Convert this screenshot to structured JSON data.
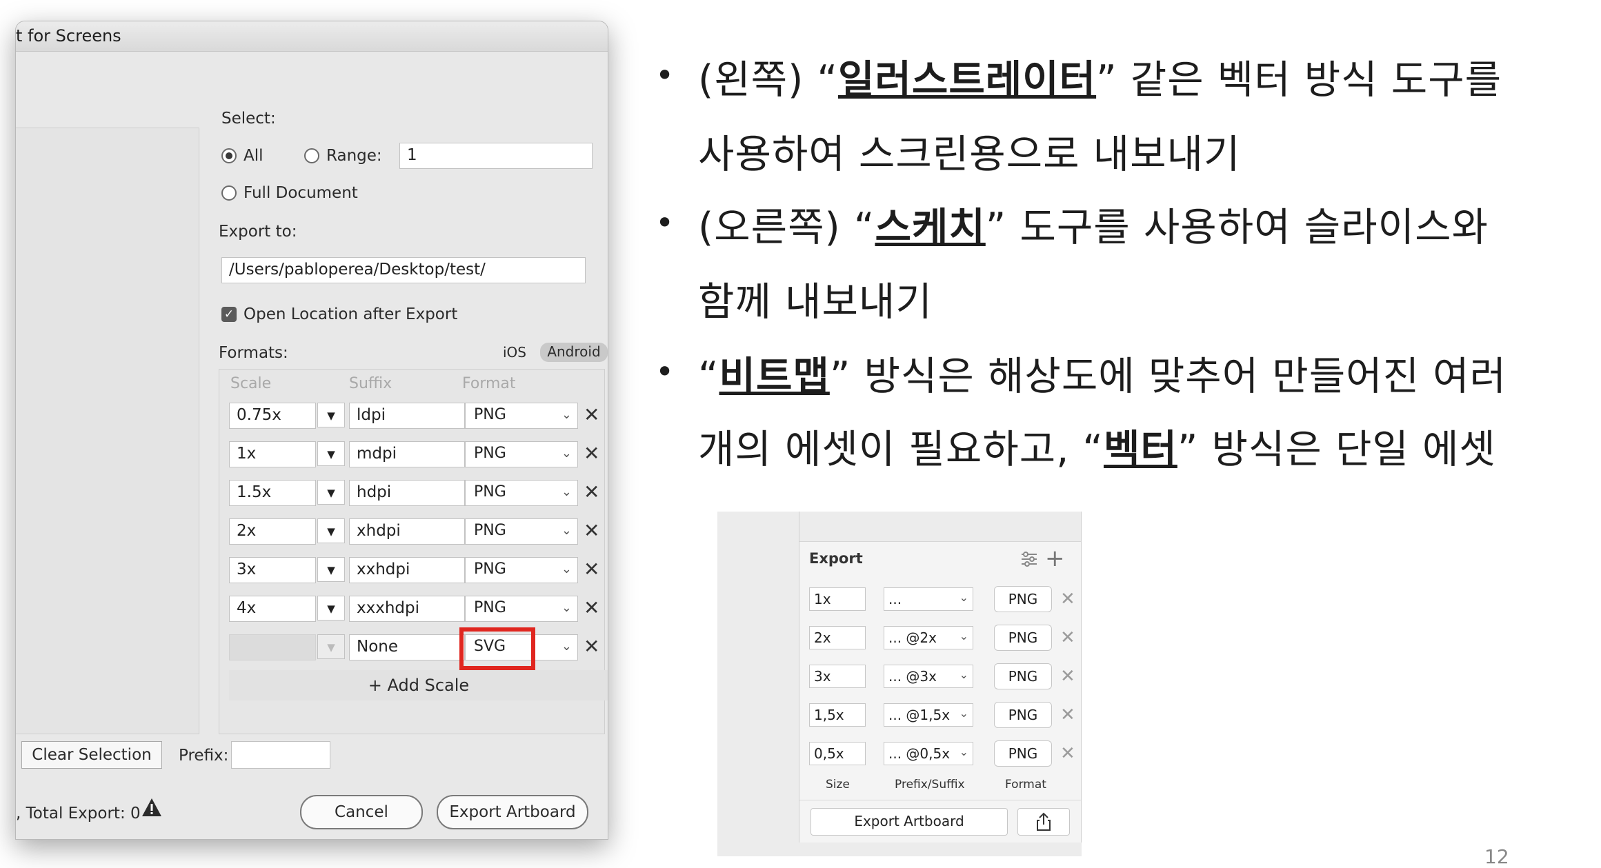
{
  "dialog": {
    "title": "t for Screens",
    "select_label": "Select:",
    "all_label": "All",
    "range_label": "Range:",
    "range_value": "1",
    "full_document_label": "Full Document",
    "export_to_label": "Export to:",
    "export_path": "/Users/pabloperea/Desktop/test/",
    "open_location_label": "Open Location after Export",
    "formats_label": "Formats:",
    "ios_label": "iOS",
    "android_label": "Android",
    "col_scale": "Scale",
    "col_suffix": "Suffix",
    "col_format": "Format",
    "rows": [
      {
        "scale": "0.75x",
        "suffix": "ldpi",
        "format": "PNG"
      },
      {
        "scale": "1x",
        "suffix": "mdpi",
        "format": "PNG"
      },
      {
        "scale": "1.5x",
        "suffix": "hdpi",
        "format": "PNG"
      },
      {
        "scale": "2x",
        "suffix": "xhdpi",
        "format": "PNG"
      },
      {
        "scale": "3x",
        "suffix": "xxhdpi",
        "format": "PNG"
      },
      {
        "scale": "4x",
        "suffix": "xxxhdpi",
        "format": "PNG"
      },
      {
        "scale": "",
        "suffix": "None",
        "format": "SVG"
      }
    ],
    "add_scale_label": "+ Add Scale",
    "clear_selection_label": "Clear Selection",
    "prefix_label": "Prefix:",
    "prefix_value": "",
    "total_export_label": ", Total Export: 0",
    "cancel_label": "Cancel",
    "export_artboard_label": "Export Artboard",
    "highlight_color": "#e0261f"
  },
  "bullets": {
    "b1_pre": "(왼쪽) “",
    "b1_bold": "일러스트레이터",
    "b1_post": "” 같은 벡터 방식 도구를",
    "b1_line2": "사용하여 스크린용으로 내보내기",
    "b2_pre": "(오른쪽) “",
    "b2_bold": "스케치",
    "b2_post": "” 도구를 사용하여 슬라이스와",
    "b2_line2": "함께 내보내기",
    "b3_pre": "“",
    "b3_bold": "비트맵",
    "b3_post": "” 방식은 해상도에 맞추어 만들어진 여러",
    "b3_line2_pre": "개의 에셋이 필요하고, “",
    "b3_line2_bold": "벡터",
    "b3_line2_post": "” 방식은 단일 에셋"
  },
  "sketch": {
    "title": "Export",
    "rows": [
      {
        "size": "1x",
        "suffix": "...",
        "format": "PNG"
      },
      {
        "size": "2x",
        "suffix": "... @2x",
        "format": "PNG"
      },
      {
        "size": "3x",
        "suffix": "... @3x",
        "format": "PNG"
      },
      {
        "size": "1,5x",
        "suffix": "... @1,5x",
        "format": "PNG"
      },
      {
        "size": "0,5x",
        "suffix": "... @0,5x",
        "format": "PNG"
      }
    ],
    "cap_size": "Size",
    "cap_prefix": "Prefix/Suffix",
    "cap_format": "Format",
    "export_artboard_label": "Export Artboard"
  },
  "page_number": "12",
  "icons": [
    "folder-icon",
    "gear-icon",
    "warning-icon",
    "close-icon",
    "chevron-down-icon",
    "settings-sliders-icon",
    "plus-icon",
    "share-icon"
  ]
}
